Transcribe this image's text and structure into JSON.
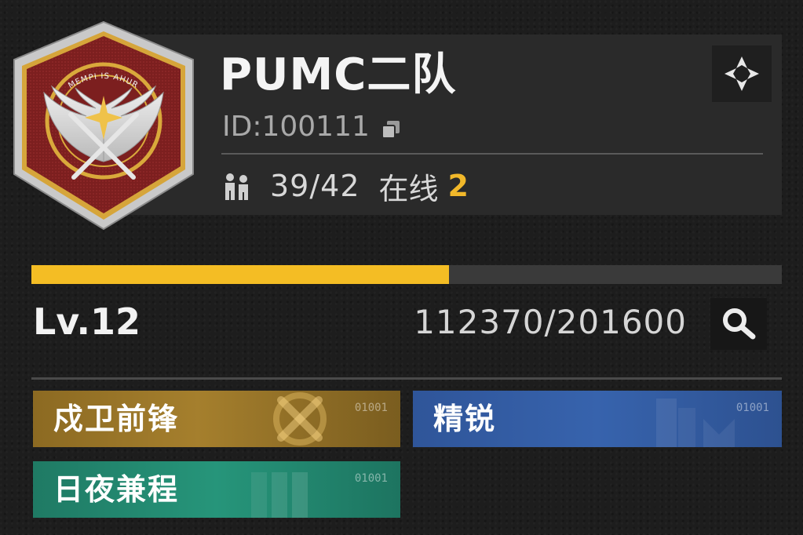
{
  "team": {
    "name": "PUMC二队",
    "id_label": "ID:",
    "id_value": "100111",
    "members": "39/42",
    "online_label": "在线",
    "online_count": "2",
    "emblem_motto": "MEMPI IS AHUR"
  },
  "level": {
    "label": "Lv.12",
    "exp_current": 112370,
    "exp_max": 201600,
    "exp_text": "112370/201600",
    "progress_fraction": 0.557
  },
  "tags": [
    {
      "label": "戍卫前锋",
      "code": "01001",
      "color": "#a17b2c"
    },
    {
      "label": "精锐",
      "code": "01001",
      "color": "#3763ad"
    },
    {
      "label": "日夜兼程",
      "code": "01001",
      "color": "#26957a"
    }
  ],
  "icons": {
    "emblem": "wings-star-emblem",
    "copy": "copy-icon",
    "members": "members-icon",
    "locate": "target-icon",
    "search": "search-icon"
  },
  "colors": {
    "accent": "#f4bd24",
    "online": "#f1b82a",
    "panel": "#2a2a2a"
  }
}
